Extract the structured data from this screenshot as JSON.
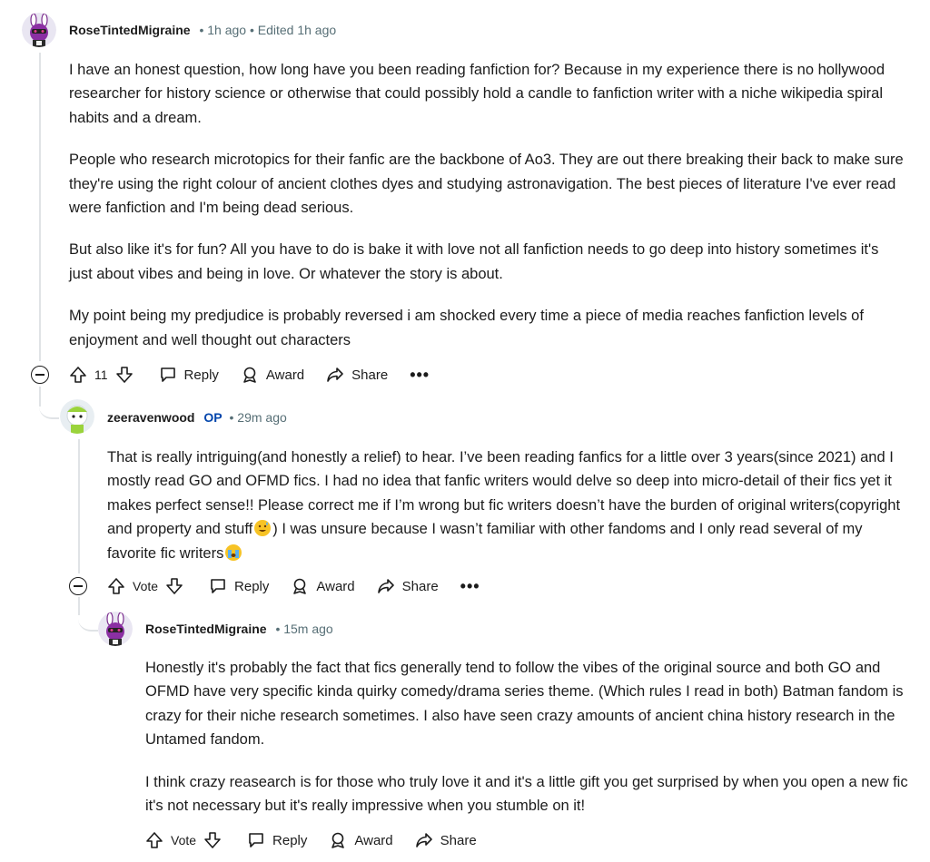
{
  "comments": [
    {
      "user": "RoseTintedMigraine",
      "meta": "• 1h ago • Edited 1h ago",
      "paragraphs": [
        "I have an honest question, how long have you been reading fanfiction for? Because in my experience there is no hollywood researcher for history science or otherwise that could possibly hold a candle to fanfiction writer with a niche wikipedia spiral habits and a dream.",
        "People who research microtopics for their fanfic are the backbone of Ao3. They are out there breaking their back to make sure they're using the right colour of ancient clothes dyes and studying astronavigation. The best pieces of literature I've ever read were fanfiction and I'm being dead serious.",
        "But also like it's for fun? All you have to do is bake it with love not all fanfiction needs to go deep into history sometimes it's just about vibes and being in love. Or whatever the story is about.",
        "My point being my predjudice is probably reversed i am shocked every time a piece of media reaches fanfiction levels of enjoyment and well thought out characters"
      ],
      "votes": "11",
      "reply": "Reply",
      "award": "Award",
      "share": "Share",
      "more": "•••"
    },
    {
      "user": "zeeravenwood",
      "op": "OP",
      "meta": "• 29m ago",
      "text_a": "That is really intriguing(and honestly a relief) to hear. I’ve been reading fanfics for a little over 3 years(since 2021) and I mostly read GO and OFMD fics. I had no idea that fanfic writers would delve so deep into micro-detail of their fics yet it makes perfect sense!! Please correct me if I’m wrong but fic writers doesn’t have the burden of original writers(copyright and property and stuff",
      "text_b": ") I was unsure because I wasn’t familiar with other fandoms and I only read several of my favorite fic writers",
      "votes": "Vote",
      "reply": "Reply",
      "award": "Award",
      "share": "Share",
      "more": "•••"
    },
    {
      "user": "RoseTintedMigraine",
      "meta": "• 15m ago",
      "paragraphs": [
        "Honestly it's probably the fact that fics generally tend to follow the vibes of the original source and both GO and OFMD have very specific kinda quirky comedy/drama series theme. (Which rules I read in both) Batman fandom is crazy for their niche research sometimes. I also have seen crazy amounts of ancient china history research in the Untamed fandom.",
        "I think crazy reasearch is for those who truly love it and it's a little gift you get surprised by when you open a new fic it's not necessary but it's really impressive when you stumble on it!"
      ],
      "votes": "Vote",
      "reply": "Reply",
      "award": "Award",
      "share": "Share"
    }
  ],
  "colors": {
    "meta": "#576f76",
    "op": "#0045ac",
    "line": "#e0e3e6"
  },
  "icons": [
    "upvote-icon",
    "downvote-icon",
    "reply-bubble-icon",
    "award-icon",
    "share-icon",
    "collapse-icon",
    "more-icon"
  ]
}
